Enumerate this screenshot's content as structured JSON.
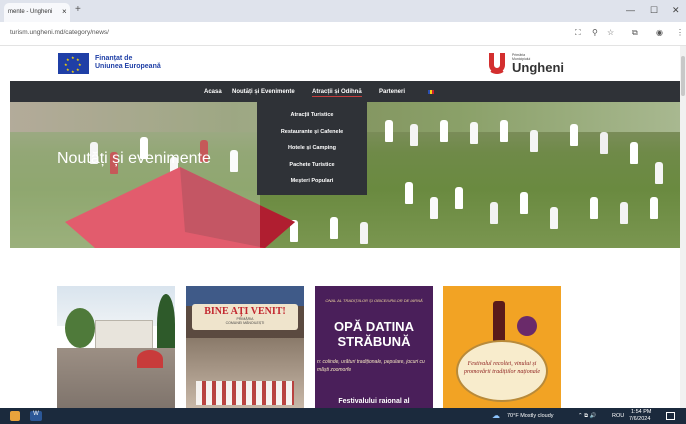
{
  "browser": {
    "tab_title": "mente - Ungheni",
    "url": "turism.ungheni.md/category/news/",
    "new_tab": "+",
    "tab_close": "×",
    "win_min": "—",
    "win_max": "☐",
    "win_close": "✕"
  },
  "header": {
    "eu_line1": "Finanțat de",
    "eu_line2": "Uniunea Europeană",
    "logo_small_1": "Primăria",
    "logo_small_2": "Municipiului",
    "logo_big": "Ungheni"
  },
  "nav": {
    "items": [
      "Acasa",
      "Noutăți și Evenimente",
      "Atracții și Odihnă",
      "Parteneri"
    ],
    "active_index": 2
  },
  "dropdown": {
    "items": [
      "Atracții Turistice",
      "Restaurante și Cafenele",
      "Hotele și Camping",
      "Pachete Turistice",
      "Meșteri Populari"
    ]
  },
  "hero": {
    "title": "Noutăți și evenimente"
  },
  "cards": [
    {
      "alt": "town square photo"
    },
    {
      "banner": "BINE AȚI VENIT!",
      "sub1": "PRIMĂRIA",
      "sub2": "COMUNEI MĂNOILEȘTI"
    },
    {
      "header": "ONAL AL TRADIȚIILOR ȘI OBICEIURILOR DE IARNĂ",
      "title1": "OPĂ DATINA",
      "title2": "STRĂBUNĂ",
      "sub": "n: colinde, urături tradiționale, pepulare, jocuri cu măști zoomorfe",
      "footer": "Festivalului raional al"
    },
    {
      "text": "Festivalul recoltei, vinului și promovării tradițiilor naționale"
    }
  ],
  "taskbar": {
    "weather": "70°F  Mostly cloudy",
    "lang": "ROU",
    "time": "1:54 PM",
    "date": "7/6/2024"
  },
  "colors": {
    "nav_bg": "#2f3237",
    "eu_blue": "#1f3fa6",
    "logo_red": "#d32f2f"
  }
}
